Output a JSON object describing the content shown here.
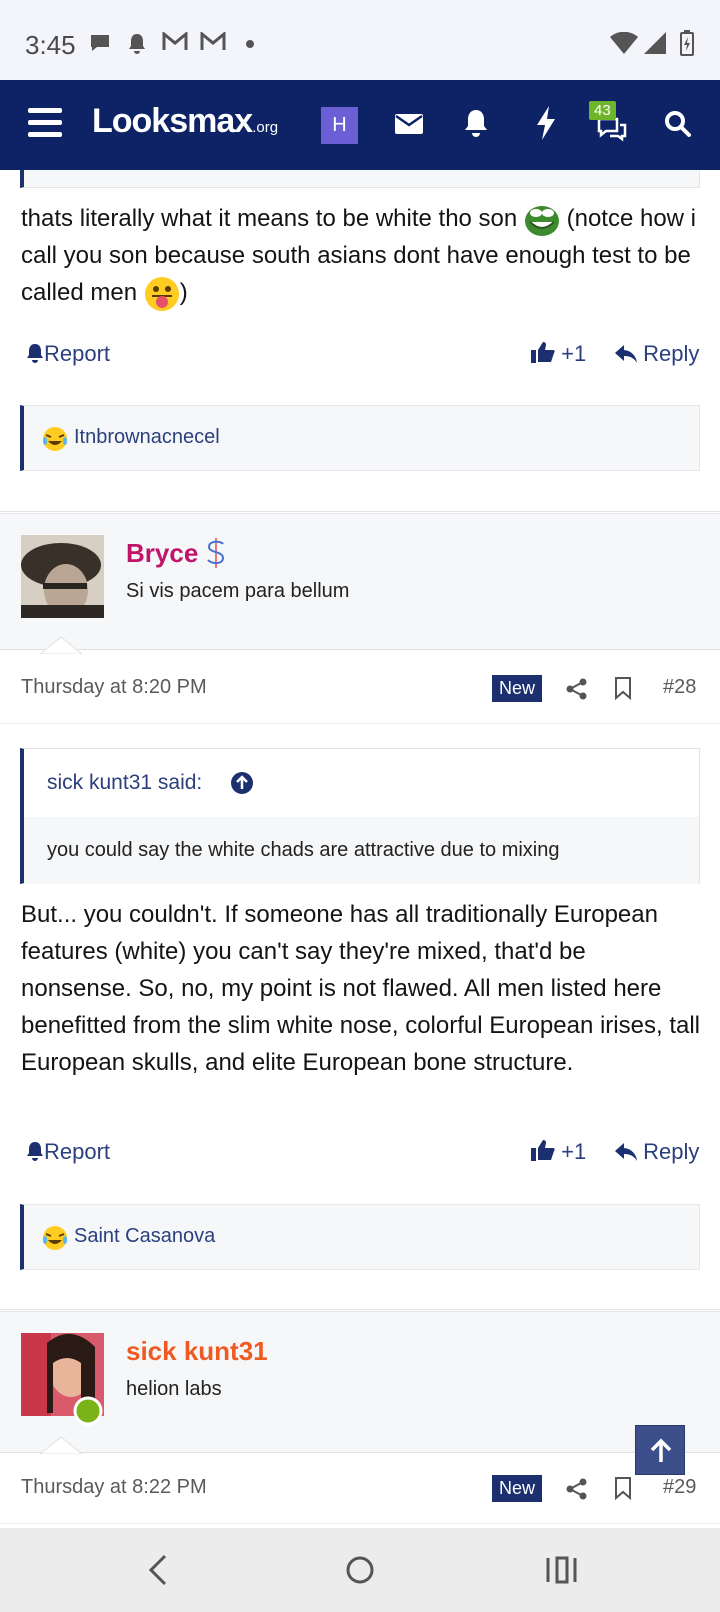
{
  "status_bar": {
    "time": "3:45"
  },
  "header": {
    "logo_text": "Looksmax",
    "logo_suffix": ".org",
    "avatar_letter": "H",
    "conversations_badge": "43"
  },
  "post_27": {
    "body_part1": "thats literally what it means to be white tho son",
    "body_part2": "(notce how i call you son because south asians dont have enough test to be called men",
    "body_part3": ")",
    "report_label": "Report",
    "like_label": "+1",
    "reply_label": "Reply",
    "reaction_user": "Itnbrownacnecel"
  },
  "post_28": {
    "username": "Bryce",
    "user_title": "Si vis pacem para bellum",
    "date": "Thursday at 8:20 PM",
    "new_label": "New",
    "post_number": "#28",
    "quote_author": "sick kunt31 said:",
    "quote_text": "you could say the white chads are attractive due to mixing",
    "body": "But... you couldn't. If someone has all traditionally European features (white) you can't say they're mixed, that'd be nonsense. So, no, my point is not flawed. All men listed here benefitted from the slim white nose, colorful European irises, tall European skulls, and elite European bone structure.",
    "report_label": "Report",
    "like_label": "+1",
    "reply_label": "Reply",
    "reaction_user": "Saint Casanova"
  },
  "post_29": {
    "username": "sick kunt31",
    "user_title": "helion labs",
    "date": "Thursday at 8:22 PM",
    "new_label": "New",
    "post_number": "#29"
  },
  "colors": {
    "header_bg": "#0d2366",
    "link": "#2b3f7e",
    "bryce_name": "#c0146a",
    "sick_kunt_name": "#f05a22",
    "online": "#7ab317"
  }
}
